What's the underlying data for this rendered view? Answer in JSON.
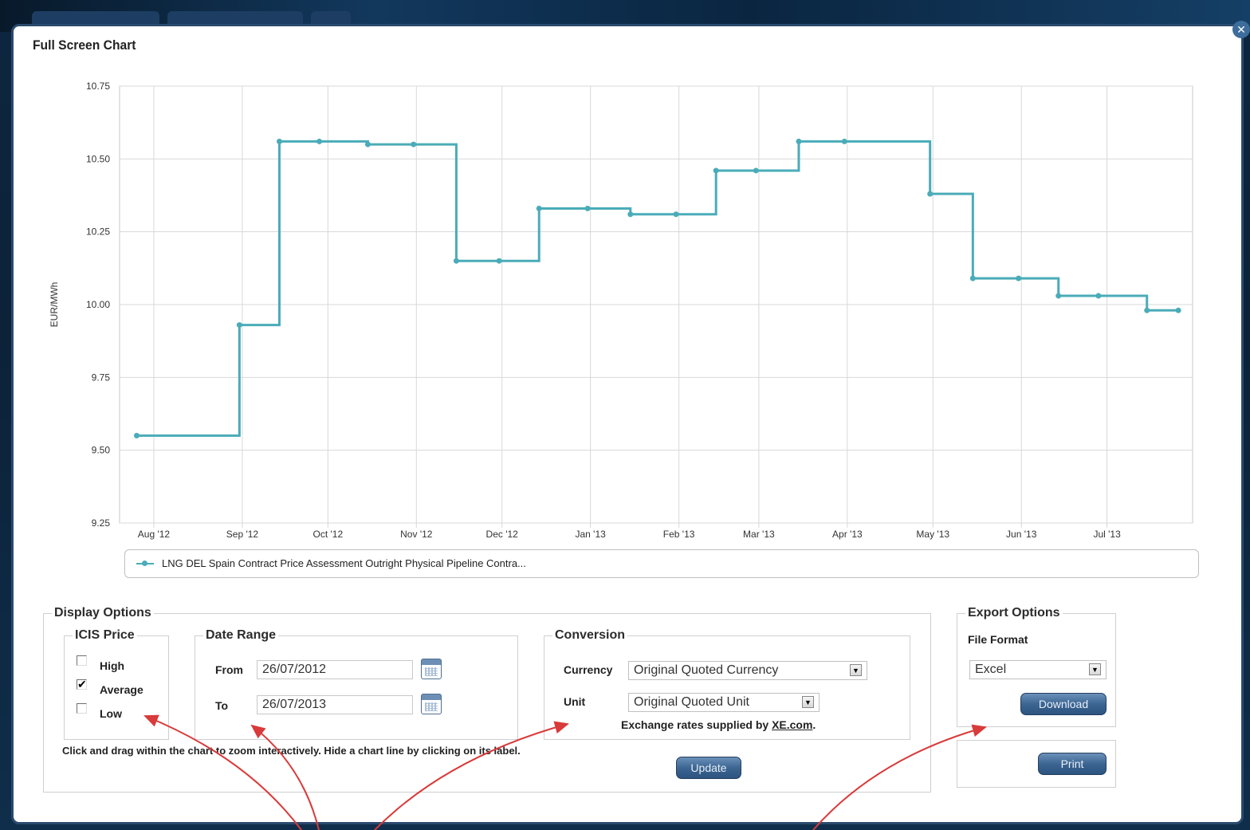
{
  "window": {
    "title": "Full Screen Chart",
    "close_icon": "close-icon"
  },
  "chart_data": {
    "type": "line",
    "step": true,
    "ylabel": "EUR/MWh",
    "ylim": [
      9.25,
      10.75
    ],
    "yticks": [
      "10.75",
      "10.50",
      "10.25",
      "10.00",
      "9.75",
      "9.50",
      "9.25"
    ],
    "xticks": [
      "Aug '12",
      "Sep '12",
      "Oct '12",
      "Nov '12",
      "Dec '12",
      "Jan '13",
      "Feb '13",
      "Mar '13",
      "Apr '13",
      "May '13",
      "Jun '13",
      "Jul '13"
    ],
    "grid": true,
    "series": [
      {
        "name": "LNG DEL Spain Contract Price Assessment Outright Physical Pipeline Contra...",
        "color": "#4aacb8",
        "points": [
          {
            "x": "2012-07-26",
            "y": 9.55
          },
          {
            "x": "2012-08-31",
            "y": 9.93
          },
          {
            "x": "2012-09-14",
            "y": 10.56
          },
          {
            "x": "2012-09-28",
            "y": 10.56
          },
          {
            "x": "2012-10-15",
            "y": 10.55
          },
          {
            "x": "2012-10-31",
            "y": 10.55
          },
          {
            "x": "2012-11-15",
            "y": 10.15
          },
          {
            "x": "2012-11-30",
            "y": 10.15
          },
          {
            "x": "2012-12-14",
            "y": 10.33
          },
          {
            "x": "2012-12-31",
            "y": 10.33
          },
          {
            "x": "2013-01-15",
            "y": 10.31
          },
          {
            "x": "2013-01-31",
            "y": 10.31
          },
          {
            "x": "2013-02-14",
            "y": 10.46
          },
          {
            "x": "2013-02-28",
            "y": 10.46
          },
          {
            "x": "2013-03-15",
            "y": 10.56
          },
          {
            "x": "2013-03-31",
            "y": 10.56
          },
          {
            "x": "2013-04-30",
            "y": 10.38
          },
          {
            "x": "2013-05-15",
            "y": 10.09
          },
          {
            "x": "2013-05-31",
            "y": 10.09
          },
          {
            "x": "2013-06-14",
            "y": 10.03
          },
          {
            "x": "2013-06-28",
            "y": 10.03
          },
          {
            "x": "2013-07-15",
            "y": 9.98
          },
          {
            "x": "2013-07-26",
            "y": 9.98
          }
        ]
      }
    ]
  },
  "instructions": "Click and drag within the chart to zoom interactively. Hide a chart line by clicking on its label.",
  "display_options": {
    "title": "Display Options",
    "icis_price": {
      "title": "ICIS Price",
      "items": [
        {
          "label": "High",
          "checked": false
        },
        {
          "label": "Average",
          "checked": true
        },
        {
          "label": "Low",
          "checked": false
        }
      ]
    },
    "date_range": {
      "title": "Date Range",
      "from_label": "From",
      "from_value": "26/07/2012",
      "to_label": "To",
      "to_value": "26/07/2013"
    },
    "conversion": {
      "title": "Conversion",
      "currency_label": "Currency",
      "currency_value": "Original Quoted Currency",
      "unit_label": "Unit",
      "unit_value": "Original Quoted Unit",
      "exchange_note": "Exchange rates supplied by",
      "exchange_link": "XE.com",
      "exchange_note_end": "."
    },
    "update_button": "Update"
  },
  "export_options": {
    "title": "Export Options",
    "file_format_label": "File Format",
    "file_format_value": "Excel",
    "download_button": "Download",
    "print_button": "Print"
  },
  "annotation_arrow_color": "#d93a3a"
}
